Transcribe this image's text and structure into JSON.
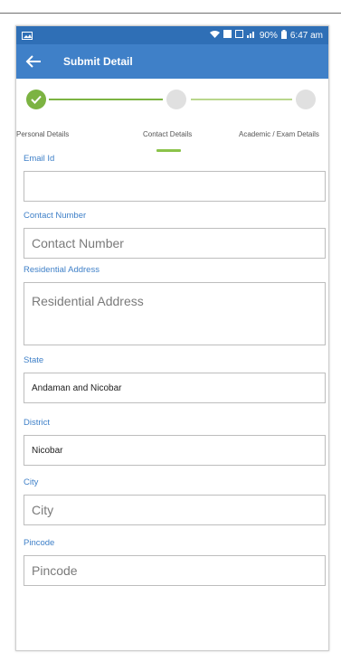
{
  "status_bar": {
    "battery_percent": "90%",
    "time": "6:47 am"
  },
  "appbar": {
    "title": "Submit Detail"
  },
  "stepper": {
    "steps": [
      {
        "label": "Personal Details",
        "state": "done"
      },
      {
        "label": "Contact Details",
        "state": "active"
      },
      {
        "label": "Academic / Exam Details",
        "state": "pending"
      }
    ]
  },
  "form": {
    "email": {
      "label": "Email Id",
      "value": "",
      "placeholder": ""
    },
    "contact_number": {
      "label": "Contact Number",
      "placeholder": "Contact Number"
    },
    "residential_address": {
      "label": "Residential Address",
      "placeholder": "Residential Address"
    },
    "state": {
      "label": "State",
      "value": "Andaman and Nicobar"
    },
    "district": {
      "label": "District",
      "value": "Nicobar"
    },
    "city": {
      "label": "City",
      "placeholder": "City"
    },
    "pincode": {
      "label": "Pincode",
      "placeholder": "Pincode"
    }
  },
  "colors": {
    "primary": "#3f80c8",
    "status_bar": "#2f6fb6",
    "step_done": "#7cb342",
    "step_pending": "#e0e0e0"
  }
}
